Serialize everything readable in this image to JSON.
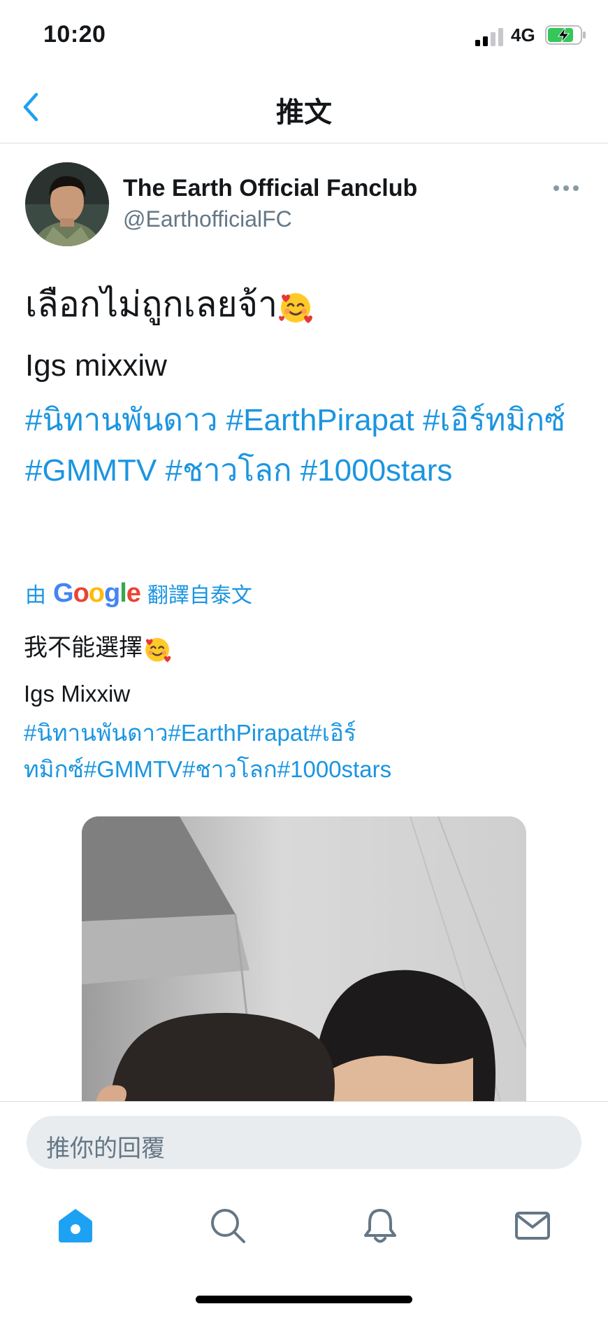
{
  "status_bar": {
    "time": "10:20",
    "network": "4G"
  },
  "nav": {
    "title": "推文"
  },
  "author": {
    "name": "The Earth Official Fanclub",
    "handle": "@EarthofficialFC"
  },
  "tweet": {
    "line1": "เลือกไม่ถูกเลยจ้า",
    "line2": "Igs mixxiw",
    "hashtags": [
      "#นิทานพันดาว",
      "#EarthPirapat",
      "#เอิร์ทมิกซ์",
      "#GMMTV",
      "#ชาวโลก",
      "#1000stars"
    ]
  },
  "translation": {
    "by": "由",
    "google": "Google",
    "from": "翻譯自泰文",
    "line1": "我不能選擇",
    "line2": "Igs Mixxiw",
    "hashtags_row1": "#นิทานพันดาว#EarthPirapat#เอิร์",
    "hashtags_row2": "ทมิกซ์#GMMTV#ชาวโลก#1000stars"
  },
  "reply": {
    "placeholder": "推你的回覆"
  },
  "tab_bar": [
    {
      "name": "home-icon",
      "active": true
    },
    {
      "name": "search-icon",
      "active": false
    },
    {
      "name": "bell-icon",
      "active": false
    },
    {
      "name": "mail-icon",
      "active": false
    }
  ],
  "colors": {
    "accent": "#1da1f2",
    "link": "#1b95e0",
    "muted": "#657786"
  }
}
